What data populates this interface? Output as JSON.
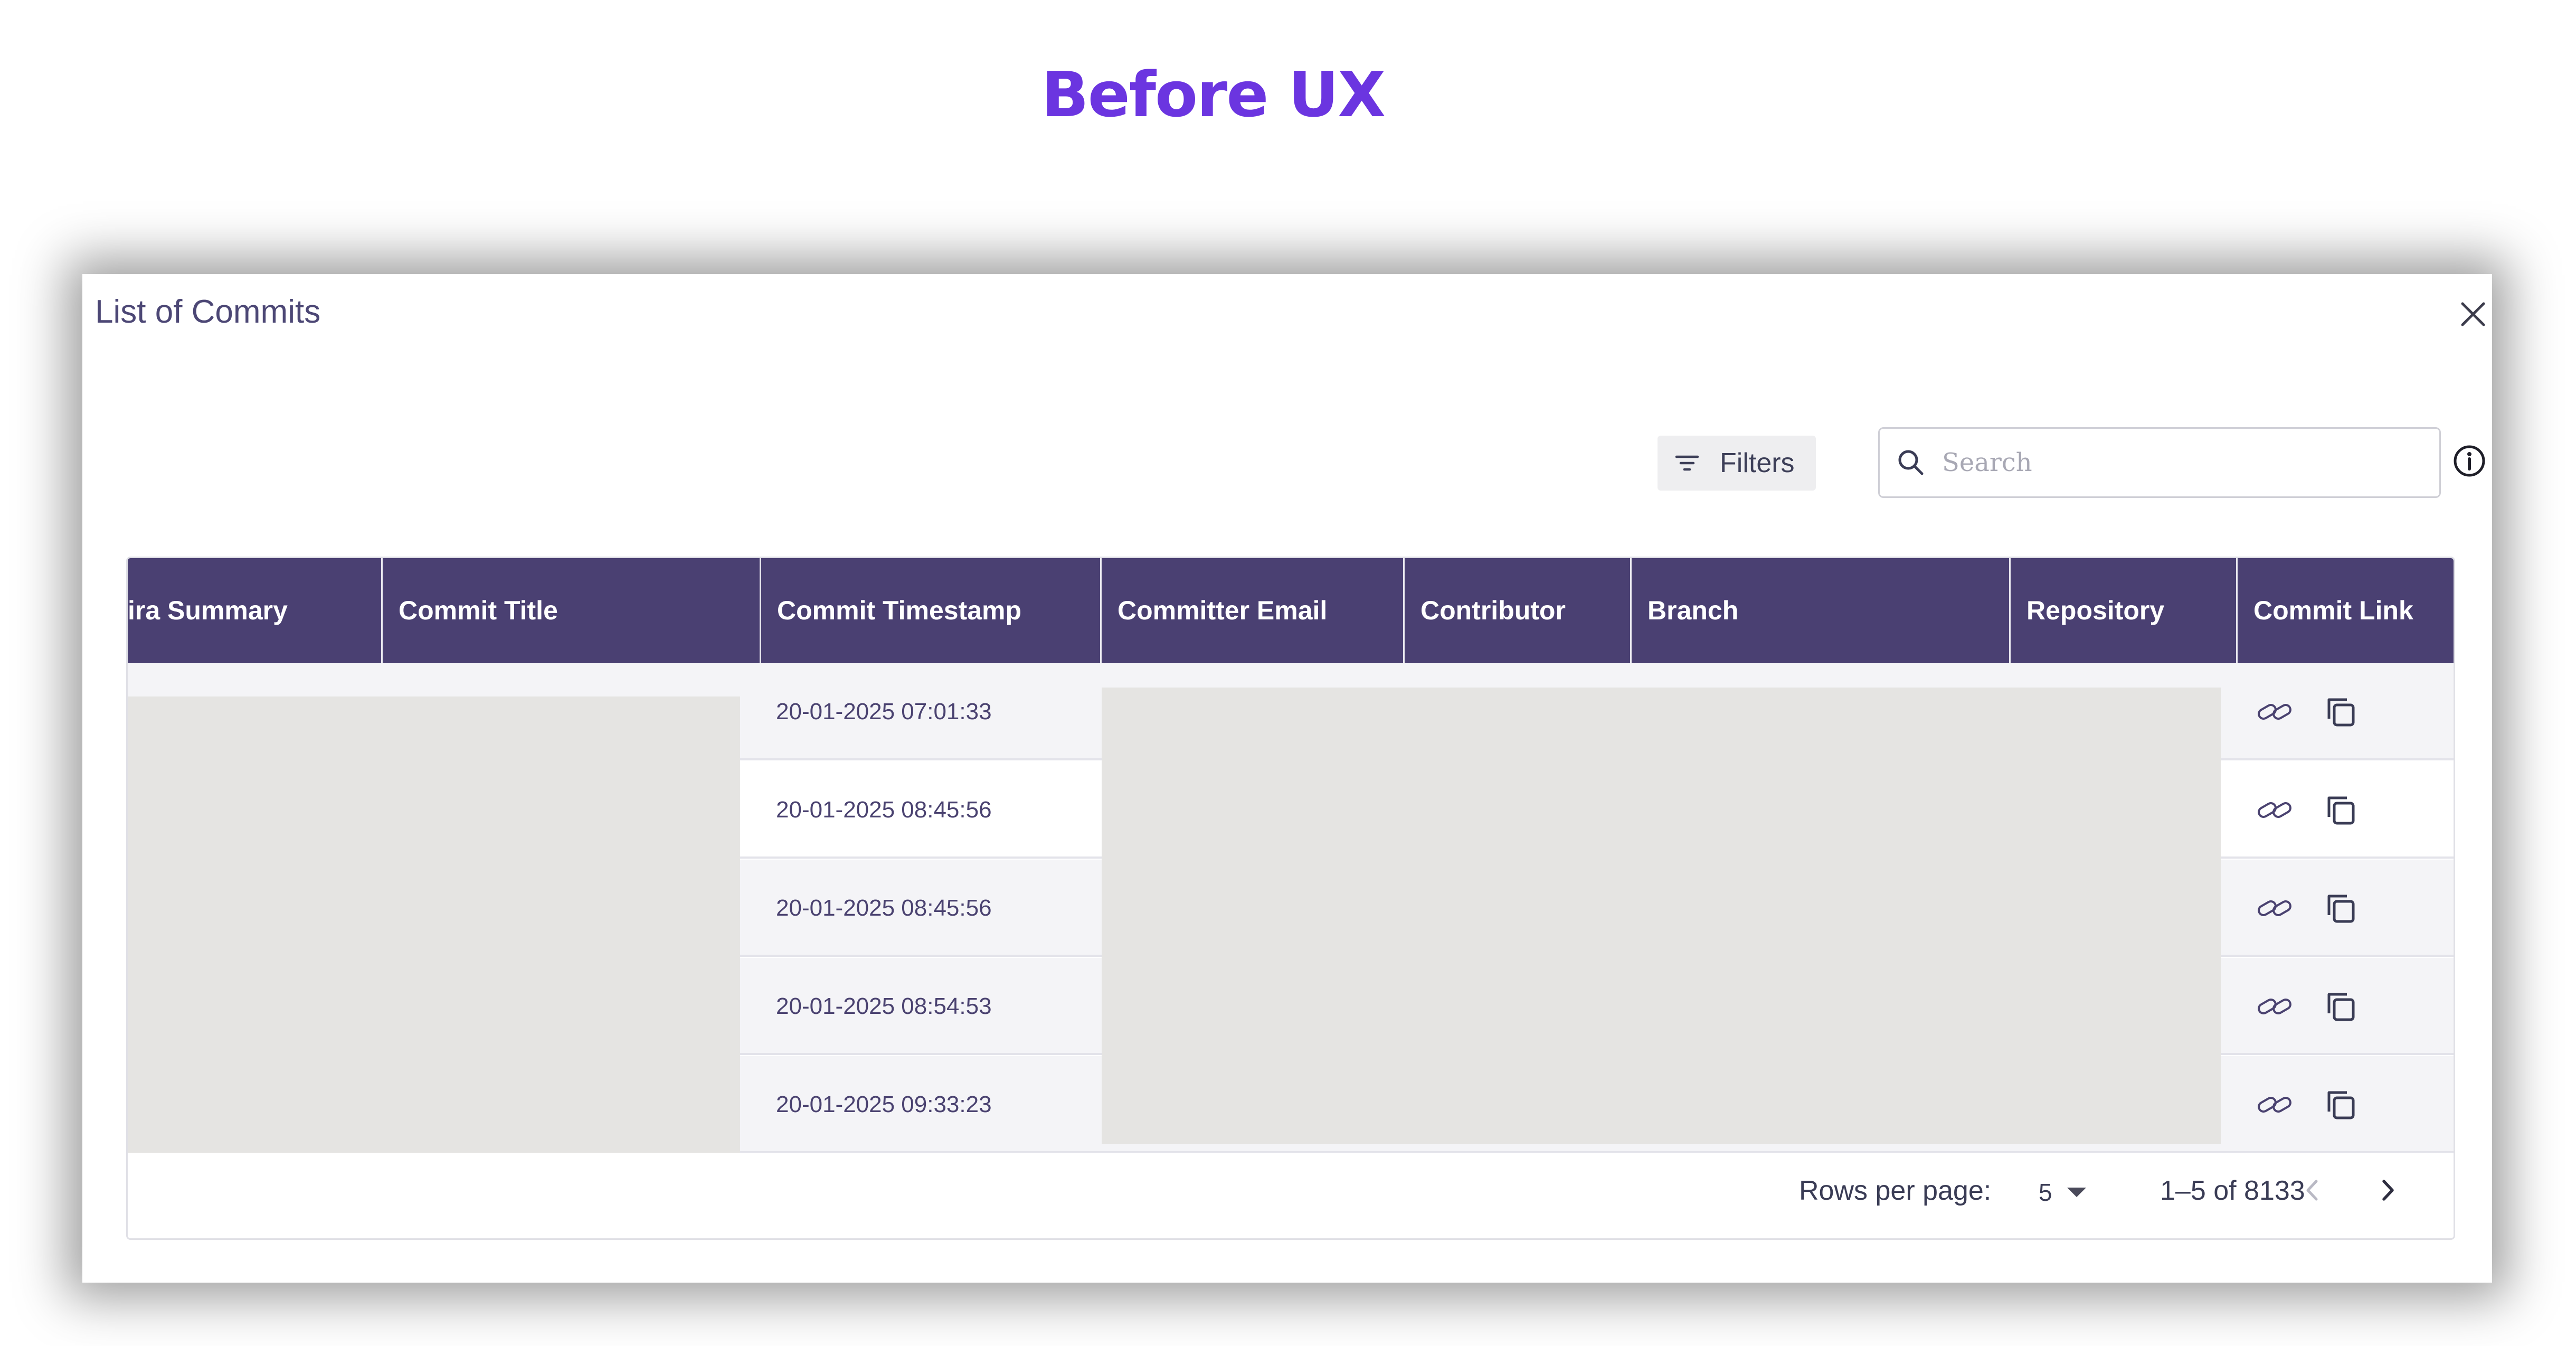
{
  "page": {
    "heading": "Before UX"
  },
  "dialog": {
    "title": "List of Commits",
    "close_icon": "close-icon"
  },
  "toolbar": {
    "filters_label": "Filters",
    "filters_icon": "filter-lines-icon",
    "search_placeholder": "Search",
    "search_value": "",
    "search_icon": "search-icon",
    "info_icon": "info-icon"
  },
  "table": {
    "columns": [
      "ira Summary",
      "Commit Title",
      "Commit Timestamp",
      "Committer Email",
      "Contributor",
      "Branch",
      "Repository",
      "Commit Link"
    ],
    "rows": [
      {
        "timestamp": "20-01-2025 07:01:33"
      },
      {
        "timestamp": "20-01-2025 08:45:56"
      },
      {
        "timestamp": "20-01-2025 08:45:56"
      },
      {
        "timestamp": "20-01-2025 08:54:53"
      },
      {
        "timestamp": "20-01-2025 09:33:23"
      }
    ],
    "row_action_icons": [
      "link-icon",
      "copy-icon"
    ]
  },
  "pagination": {
    "rows_per_page_label": "Rows per page:",
    "rows_per_page_value": "5",
    "range": "1–5 of 8133",
    "prev_icon": "chevron-left-icon",
    "next_icon": "chevron-right-icon"
  },
  "colors": {
    "heading": "#6b35e0",
    "table_header_bg": "#4a4072",
    "table_header_text": "#ffffff",
    "row_alt_bg": "#f4f4f7",
    "redaction": "#e5e4e2"
  }
}
